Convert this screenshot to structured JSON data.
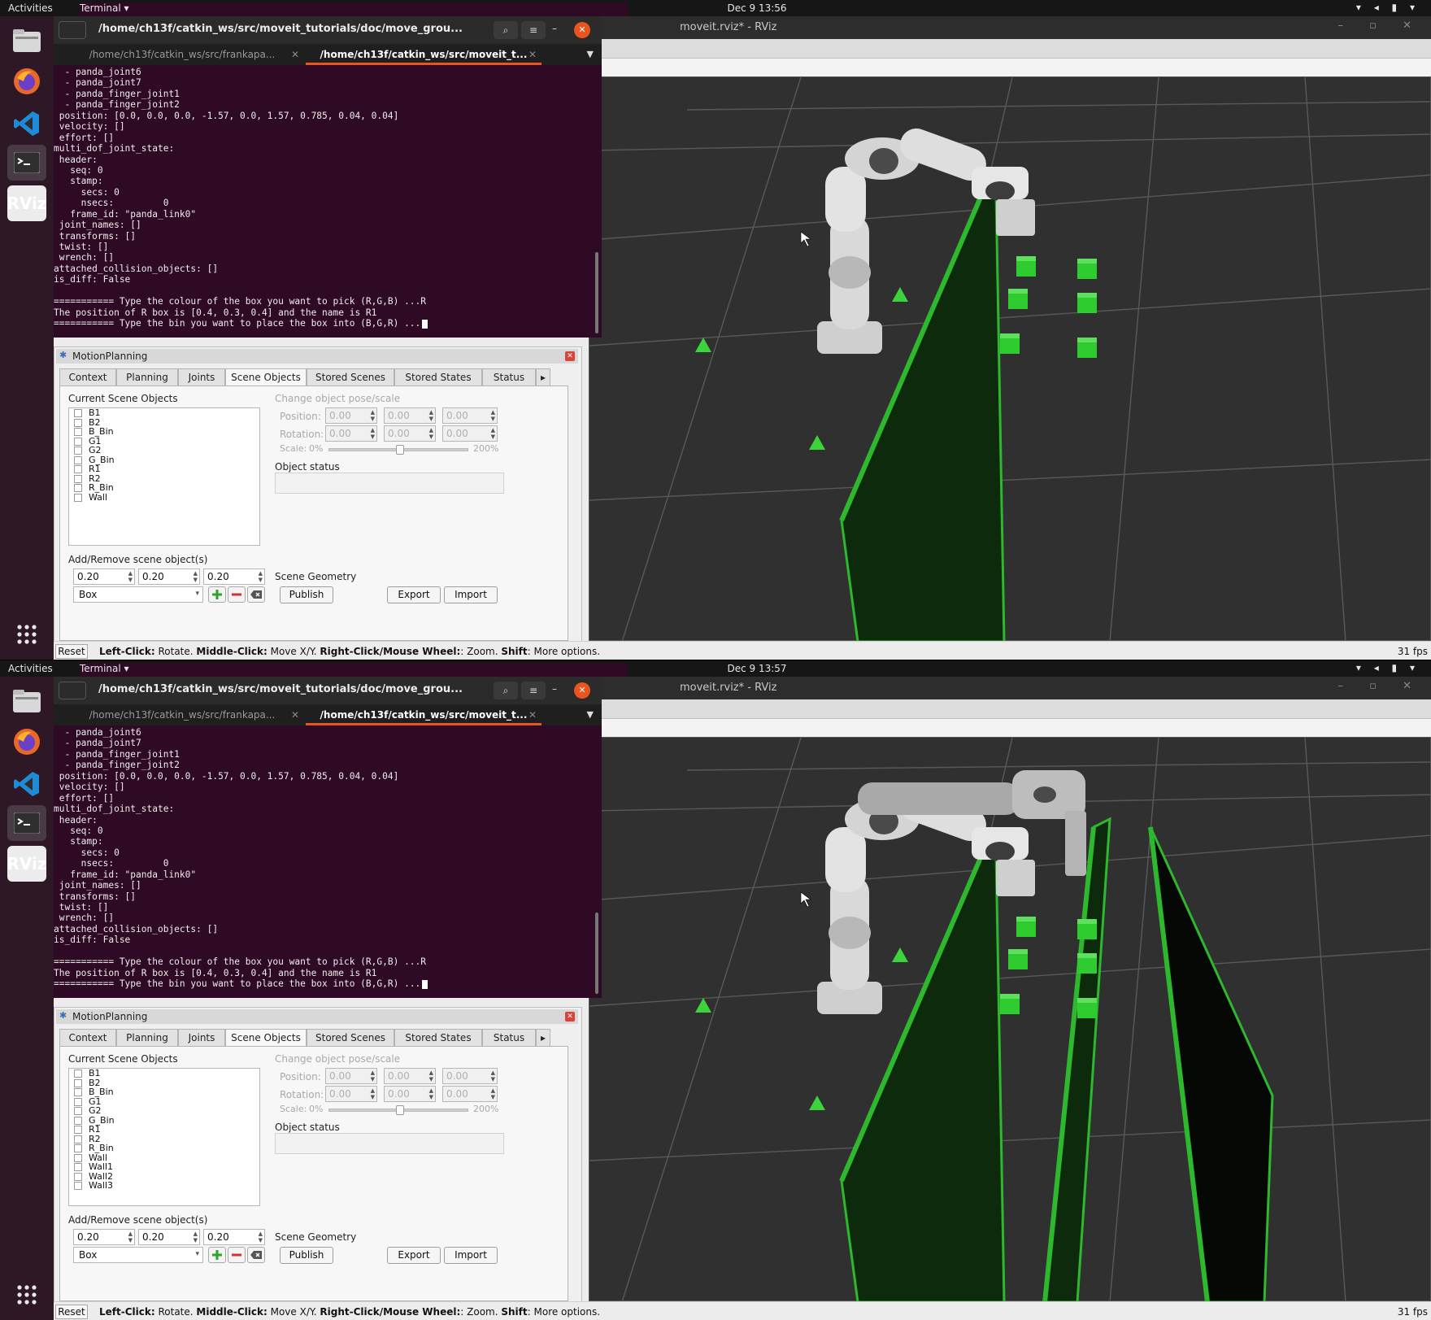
{
  "screens": [
    {
      "topbar": {
        "activities": "Activities",
        "app": "Terminal ▾",
        "clock": "Dec 9  13:56"
      },
      "terminal": {
        "title": "/home/ch13f/catkin_ws/src/moveit_tutorials/doc/move_grou...",
        "tabs": [
          "/home/ch13f/catkin_ws/src/frankapa...",
          "/home/ch13f/catkin_ws/src/moveit_t..."
        ],
        "lines": [
          "  - panda_joint6",
          "  - panda_joint7",
          "  - panda_finger_joint1",
          "  - panda_finger_joint2",
          " position: [0.0, 0.0, 0.0, -1.57, 0.0, 1.57, 0.785, 0.04, 0.04]",
          " velocity: []",
          " effort: []",
          "multi_dof_joint_state:",
          " header:",
          "   seq: 0",
          "   stamp:",
          "     secs: 0",
          "     nsecs:         0",
          "   frame_id: \"panda_link0\"",
          " joint_names: []",
          " transforms: []",
          " twist: []",
          " wrench: []",
          "attached_collision_objects: []",
          "is_diff: False",
          "",
          "=========== Type the colour of the box you want to pick (R,G,B) ...R",
          "The position of R box is [0.4, 0.3, 0.4] and the name is R1",
          "=========== Type the bin you want to place the box into (B,G,R) ..."
        ]
      },
      "rviz": {
        "title": "moveit.rviz* - RViz"
      },
      "panel": {
        "title": "MotionPlanning",
        "tabs": [
          "Context",
          "Planning",
          "Joints",
          "Scene Objects",
          "Stored Scenes",
          "Stored States",
          "Status"
        ],
        "current_objects_label": "Current Scene Objects",
        "objects": [
          "B1",
          "B2",
          "B_Bin",
          "G1",
          "G2",
          "G_Bin",
          "R1",
          "R2",
          "R_Bin",
          "Wall"
        ],
        "change_label": "Change object pose/scale",
        "position_label": "Position:",
        "rotation_label": "Rotation:",
        "scale_label": "Scale:",
        "scale_min": "0%",
        "scale_max": "200%",
        "pose_value": "0.00",
        "object_status_label": "Object status",
        "add_remove_label": "Add/Remove scene object(s)",
        "size_values": [
          "0.20",
          "0.20",
          "0.20"
        ],
        "shape": "Box",
        "scene_geometry_label": "Scene Geometry",
        "publish": "Publish",
        "export": "Export",
        "import": "Import"
      },
      "status": {
        "reset": "Reset",
        "hint_rotate_key": "Left-Click:",
        "hint_rotate": " Rotate. ",
        "hint_move_key": "Middle-Click:",
        "hint_move": " Move X/Y. ",
        "hint_zoom_key": "Right-Click/Mouse Wheel:",
        "hint_zoom": ": Zoom. ",
        "hint_shift_key": "Shift",
        "hint_shift": ": More options.",
        "fps": "31 fps"
      },
      "scene": {
        "walls": 1,
        "accent": "#2db82d"
      }
    },
    {
      "topbar": {
        "activities": "Activities",
        "app": "Terminal ▾",
        "clock": "Dec 9  13:57"
      },
      "terminal": {
        "title": "/home/ch13f/catkin_ws/src/moveit_tutorials/doc/move_grou...",
        "tabs": [
          "/home/ch13f/catkin_ws/src/frankapa...",
          "/home/ch13f/catkin_ws/src/moveit_t..."
        ],
        "lines": [
          "  - panda_joint6",
          "  - panda_joint7",
          "  - panda_finger_joint1",
          "  - panda_finger_joint2",
          " position: [0.0, 0.0, 0.0, -1.57, 0.0, 1.57, 0.785, 0.04, 0.04]",
          " velocity: []",
          " effort: []",
          "multi_dof_joint_state:",
          " header:",
          "   seq: 0",
          "   stamp:",
          "     secs: 0",
          "     nsecs:         0",
          "   frame_id: \"panda_link0\"",
          " joint_names: []",
          " transforms: []",
          " twist: []",
          " wrench: []",
          "attached_collision_objects: []",
          "is_diff: False",
          "",
          "=========== Type the colour of the box you want to pick (R,G,B) ...R",
          "The position of R box is [0.4, 0.3, 0.4] and the name is R1",
          "=========== Type the bin you want to place the box into (B,G,R) ..."
        ]
      },
      "rviz": {
        "title": "moveit.rviz* - RViz"
      },
      "panel": {
        "title": "MotionPlanning",
        "tabs": [
          "Context",
          "Planning",
          "Joints",
          "Scene Objects",
          "Stored Scenes",
          "Stored States",
          "Status"
        ],
        "current_objects_label": "Current Scene Objects",
        "objects": [
          "B1",
          "B2",
          "B_Bin",
          "G1",
          "G2",
          "G_Bin",
          "R1",
          "R2",
          "R_Bin",
          "Wall",
          "Wall1",
          "Wall2",
          "Wall3"
        ],
        "change_label": "Change object pose/scale",
        "position_label": "Position:",
        "rotation_label": "Rotation:",
        "scale_label": "Scale:",
        "scale_min": "0%",
        "scale_max": "200%",
        "pose_value": "0.00",
        "object_status_label": "Object status",
        "add_remove_label": "Add/Remove scene object(s)",
        "size_values": [
          "0.20",
          "0.20",
          "0.20"
        ],
        "shape": "Box",
        "scene_geometry_label": "Scene Geometry",
        "publish": "Publish",
        "export": "Export",
        "import": "Import"
      },
      "status": {
        "reset": "Reset",
        "hint_rotate_key": "Left-Click:",
        "hint_rotate": " Rotate. ",
        "hint_move_key": "Middle-Click:",
        "hint_move": " Move X/Y. ",
        "hint_zoom_key": "Right-Click/Mouse Wheel:",
        "hint_zoom": ": Zoom. ",
        "hint_shift_key": "Shift",
        "hint_shift": ": More options.",
        "fps": "31 fps"
      },
      "scene": {
        "walls": 3,
        "accent": "#2db82d"
      }
    }
  ]
}
